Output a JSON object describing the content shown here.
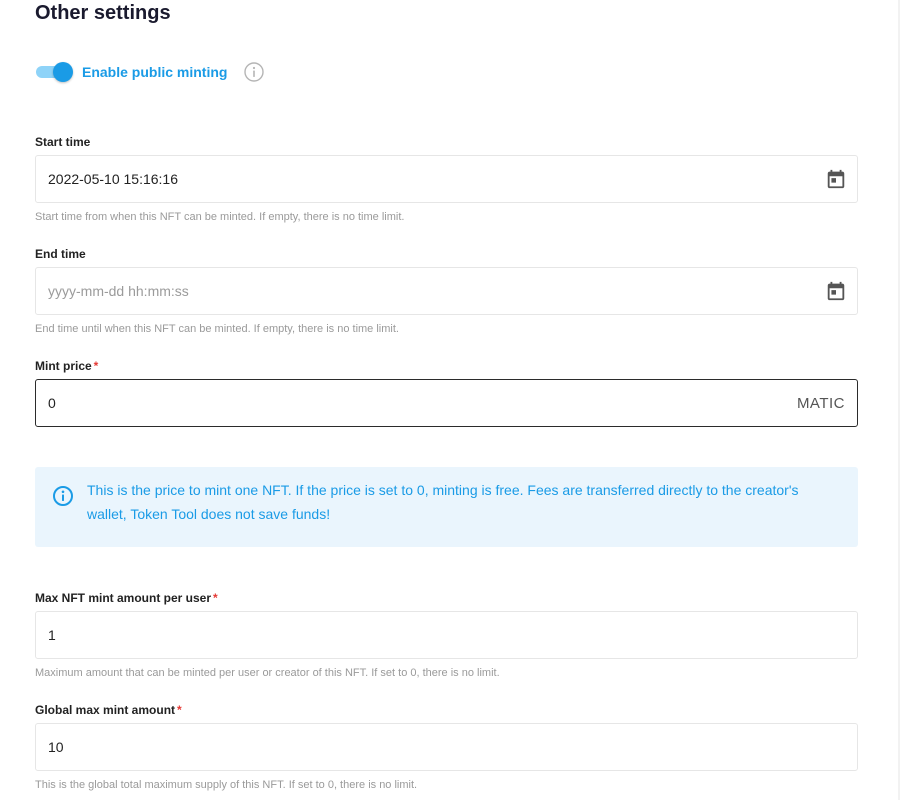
{
  "section": {
    "title": "Other settings"
  },
  "public_minting": {
    "label": "Enable public minting",
    "enabled": true
  },
  "start_time": {
    "label": "Start time",
    "value": "2022-05-10 15:16:16",
    "placeholder": "yyyy-mm-dd hh:mm:ss",
    "hint": "Start time from when this NFT can be minted. If empty, there is no time limit."
  },
  "end_time": {
    "label": "End time",
    "value": "",
    "placeholder": "yyyy-mm-dd hh:mm:ss",
    "hint": "End time until when this NFT can be minted. If empty, there is no time limit."
  },
  "mint_price": {
    "label": "Mint price",
    "required_mark": "*",
    "value": "0",
    "suffix": "MATIC"
  },
  "info": {
    "text": "This is the price to mint one NFT. If the price is set to 0, minting is free. Fees are transferred directly to the creator's wallet, Token Tool does not save funds!"
  },
  "max_per_user": {
    "label": "Max NFT mint amount per user",
    "required_mark": "*",
    "value": "1",
    "hint": "Maximum amount that can be minted per user or creator of this NFT. If set to 0, there is no limit."
  },
  "global_max": {
    "label": "Global max mint amount",
    "required_mark": "*",
    "value": "10",
    "hint": "This is the global total maximum supply of this NFT. If set to 0, there is no limit."
  },
  "colors": {
    "accent": "#1a9be6",
    "track": "#8ed3f8",
    "info_bg": "#eaf5fd",
    "required": "#e53935"
  }
}
